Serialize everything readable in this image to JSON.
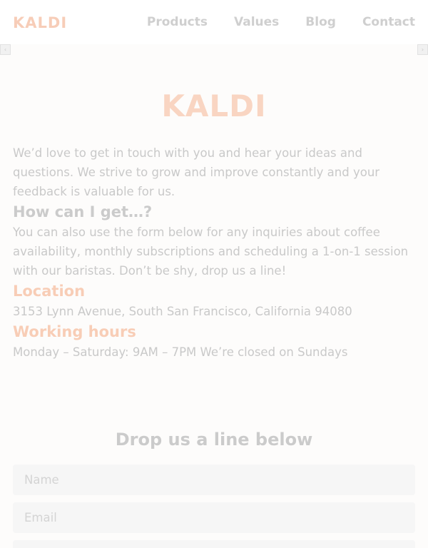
{
  "header": {
    "logo": "KALDI",
    "nav": [
      "Products",
      "Values",
      "Blog",
      "Contact"
    ]
  },
  "scroll": {
    "left_arrow": "‹",
    "right_arrow": "›"
  },
  "hero": {
    "logo": "KALDI"
  },
  "intro": {
    "text": "We’d love to get in touch with you and hear your ideas and questions. We strive to grow and improve constantly and your feedback is valuable for us."
  },
  "how": {
    "heading": "How can I get…?",
    "text": "You can also use the form below for any inquiries about coffee availability, monthly subscriptions and scheduling a 1-on-1 session with our baristas. Don’t be shy, drop us a line!"
  },
  "location": {
    "heading": "Location",
    "text": "3153 Lynn Avenue, South San Francisco, California 94080"
  },
  "hours": {
    "heading": "Working hours",
    "text": "Monday – Saturday: 9AM – 7PM We’re closed on Sundays"
  },
  "form": {
    "title": "Drop us a line below",
    "name_placeholder": "Name",
    "email_placeholder": "Email"
  },
  "colors": {
    "brand": "#f8cdb6",
    "nav_text": "#cfcfcf",
    "body_text": "#c9c9c9",
    "field_bg": "#f6f6f6"
  }
}
